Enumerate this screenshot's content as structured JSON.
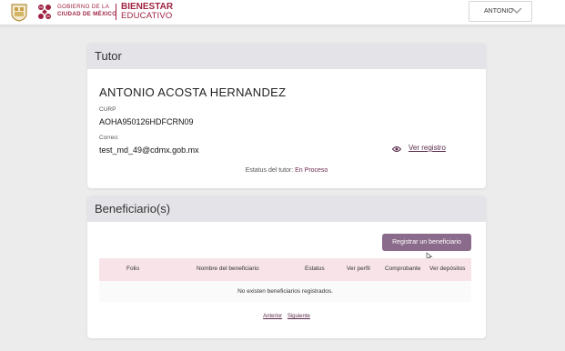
{
  "header": {
    "gov_line1": "GOBIERNO DE LA",
    "gov_line2": "CIUDAD DE MÉXICO",
    "brand_line1": "BIENESTAR",
    "brand_line2": "EDUCATIVO",
    "user_name": "ANTONIO",
    "brand_color": "#9f2241"
  },
  "tutor": {
    "title": "Tutor",
    "name": "ANTONIO ACOSTA HERNANDEZ",
    "curp_label": "CURP",
    "curp_value": "AOHA950126HDFCRN09",
    "email_label": "Correo:",
    "email_value": "test_md_49@cdmx.gob.mx",
    "view_link": "Ver registro",
    "status_label": "Estatus del tutor:",
    "status_value": "En Proceso"
  },
  "beneficiarios": {
    "title": "Beneficiario(s)",
    "register_button": "Registrar un beneficiario",
    "columns": [
      "Folio",
      "Nombre del beneficiario",
      "Estatus",
      "Ver perfil",
      "Comprobante",
      "Ver depósitos"
    ],
    "empty_message": "No existen beneficiarios registrados.",
    "prev": "Anterior",
    "next": "Siguiente"
  }
}
